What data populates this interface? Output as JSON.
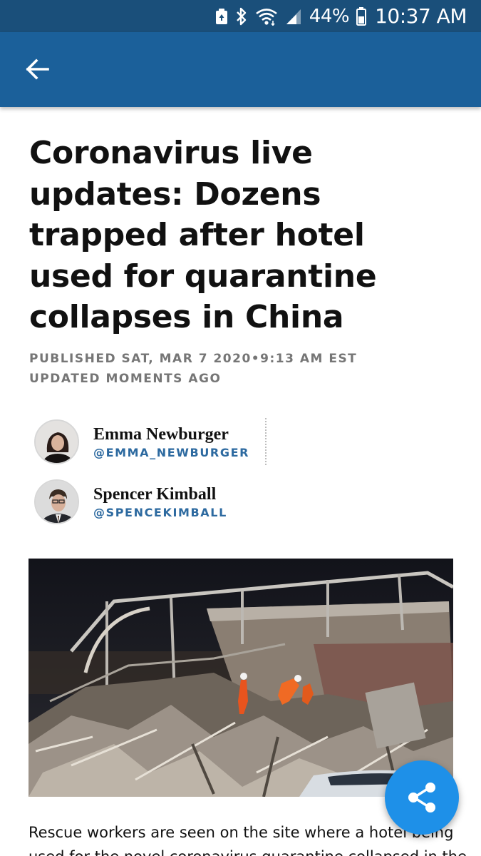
{
  "status_bar": {
    "battery_percent": "44%",
    "time": "10:37 AM",
    "icons": [
      "recycle-icon",
      "bluetooth-icon",
      "wifi-icon",
      "signal-icon",
      "battery-icon"
    ]
  },
  "app_bar": {
    "back_icon": "arrow-left-icon",
    "color": "#1b609a"
  },
  "article": {
    "headline": "Coronavirus live updates: Dozens trapped after hotel used for quarantine collapses in China",
    "published": "PUBLISHED SAT, MAR 7 2020•9:13 AM EST",
    "updated": "UPDATED MOMENTS AGO",
    "authors": [
      {
        "name": "Emma Newburger",
        "handle": "@EMMA_NEWBURGER"
      },
      {
        "name": "Spencer Kimball",
        "handle": "@SPENCEKIMBALL"
      }
    ],
    "caption_lines": [
      "Rescue workers are seen on the site where a hotel being",
      "used for the novel coronavirus quarantine collapsed in the"
    ]
  },
  "share_button": {
    "icon": "share-icon",
    "color": "#1e90e8"
  }
}
